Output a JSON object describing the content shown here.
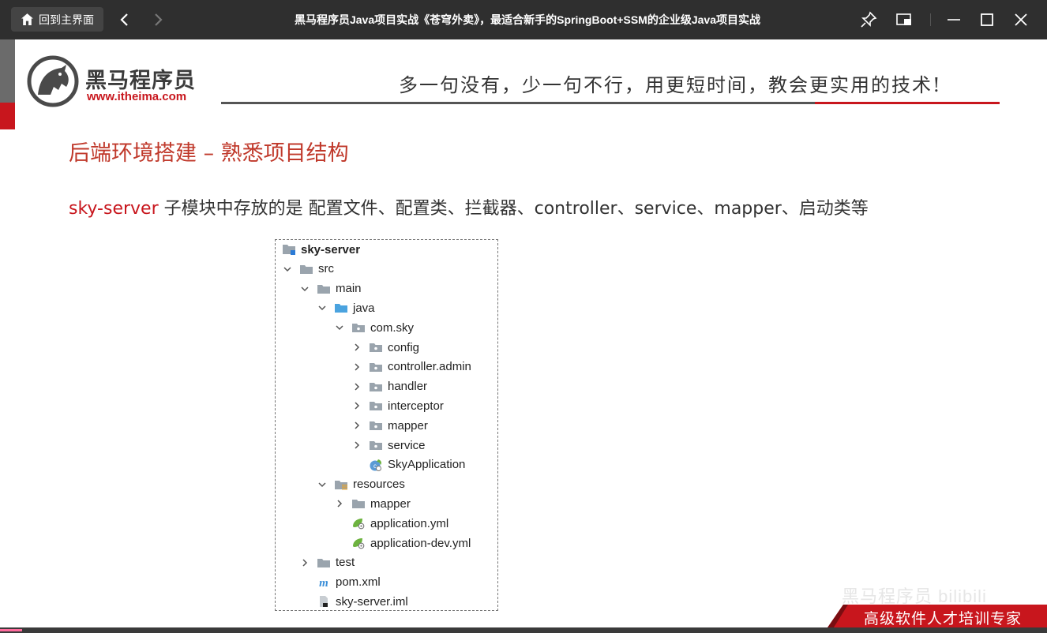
{
  "titlebar": {
    "home_label": "回到主界面",
    "title": "黑马程序员Java项目实战《苍穹外卖》，最适合新手的SpringBoot+SSM的企业级Java项目实战"
  },
  "slide": {
    "logo_cn": "黑马程序员",
    "logo_url": "www.itheima.com",
    "slogan": "多一句没有，少一句不行，用更短时间，教会更实用的技术!",
    "section_title": "后端环境搭建 – 熟悉项目结构",
    "desc_highlight": "sky-server",
    "desc_text": " 子模块中存放的是 配置文件、配置类、拦截器、controller、service、mapper、启动类等",
    "watermark": "黑马程序员 bilibili",
    "footer": "高级软件人才培训专家"
  },
  "tree": {
    "items": [
      {
        "label": "sky-server",
        "depth": 0,
        "chevron": "none",
        "icon": "module-icon",
        "bold": true
      },
      {
        "label": "src",
        "depth": 0,
        "chevron": "down",
        "icon": "folder-icon"
      },
      {
        "label": "main",
        "depth": 1,
        "chevron": "down",
        "icon": "folder-icon"
      },
      {
        "label": "java",
        "depth": 2,
        "chevron": "down",
        "icon": "source-folder-icon"
      },
      {
        "label": "com.sky",
        "depth": 3,
        "chevron": "down",
        "icon": "package-icon"
      },
      {
        "label": "config",
        "depth": 4,
        "chevron": "right",
        "icon": "package-icon"
      },
      {
        "label": "controller.admin",
        "depth": 4,
        "chevron": "right",
        "icon": "package-icon"
      },
      {
        "label": "handler",
        "depth": 4,
        "chevron": "right",
        "icon": "package-icon"
      },
      {
        "label": "interceptor",
        "depth": 4,
        "chevron": "right",
        "icon": "package-icon"
      },
      {
        "label": "mapper",
        "depth": 4,
        "chevron": "right",
        "icon": "package-icon"
      },
      {
        "label": "service",
        "depth": 4,
        "chevron": "right",
        "icon": "package-icon"
      },
      {
        "label": "SkyApplication",
        "depth": 4,
        "chevron": "none",
        "icon": "spring-class-icon"
      },
      {
        "label": "resources",
        "depth": 2,
        "chevron": "down",
        "icon": "resources-folder-icon"
      },
      {
        "label": "mapper",
        "depth": 3,
        "chevron": "right",
        "icon": "folder-icon"
      },
      {
        "label": "application.yml",
        "depth": 3,
        "chevron": "none",
        "icon": "spring-yml-icon"
      },
      {
        "label": "application-dev.yml",
        "depth": 3,
        "chevron": "none",
        "icon": "spring-yml-icon"
      },
      {
        "label": "test",
        "depth": 1,
        "chevron": "right",
        "icon": "folder-icon"
      },
      {
        "label": "pom.xml",
        "depth": 1,
        "chevron": "none",
        "icon": "maven-icon"
      },
      {
        "label": "sky-server.iml",
        "depth": 1,
        "chevron": "none",
        "icon": "iml-file-icon"
      }
    ]
  },
  "colors": {
    "accent_red": "#c8161d",
    "folder_gray": "#9aa4ad",
    "folder_blue": "#4aa3df",
    "spring_green": "#6db33f"
  }
}
